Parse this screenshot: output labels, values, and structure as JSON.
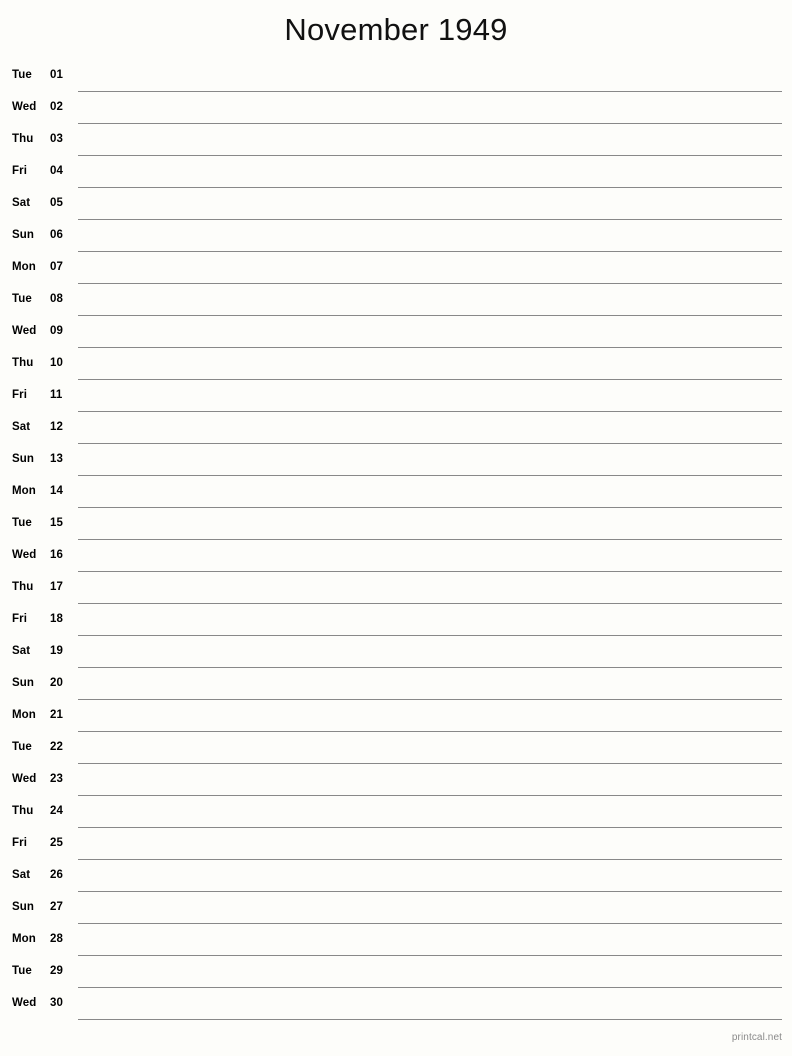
{
  "document": {
    "type": "printable-monthly-calendar",
    "title": "November 1949",
    "month": "November",
    "year": "1949"
  },
  "footer": {
    "watermark": "printcal.net"
  },
  "colors": {
    "background": "#fdfdfa",
    "text": "#000000",
    "rule_line": "#888888",
    "footer_text": "#8a8a8a"
  },
  "days": [
    {
      "weekday": "Tue",
      "number": "01"
    },
    {
      "weekday": "Wed",
      "number": "02"
    },
    {
      "weekday": "Thu",
      "number": "03"
    },
    {
      "weekday": "Fri",
      "number": "04"
    },
    {
      "weekday": "Sat",
      "number": "05"
    },
    {
      "weekday": "Sun",
      "number": "06"
    },
    {
      "weekday": "Mon",
      "number": "07"
    },
    {
      "weekday": "Tue",
      "number": "08"
    },
    {
      "weekday": "Wed",
      "number": "09"
    },
    {
      "weekday": "Thu",
      "number": "10"
    },
    {
      "weekday": "Fri",
      "number": "11"
    },
    {
      "weekday": "Sat",
      "number": "12"
    },
    {
      "weekday": "Sun",
      "number": "13"
    },
    {
      "weekday": "Mon",
      "number": "14"
    },
    {
      "weekday": "Tue",
      "number": "15"
    },
    {
      "weekday": "Wed",
      "number": "16"
    },
    {
      "weekday": "Thu",
      "number": "17"
    },
    {
      "weekday": "Fri",
      "number": "18"
    },
    {
      "weekday": "Sat",
      "number": "19"
    },
    {
      "weekday": "Sun",
      "number": "20"
    },
    {
      "weekday": "Mon",
      "number": "21"
    },
    {
      "weekday": "Tue",
      "number": "22"
    },
    {
      "weekday": "Wed",
      "number": "23"
    },
    {
      "weekday": "Thu",
      "number": "24"
    },
    {
      "weekday": "Fri",
      "number": "25"
    },
    {
      "weekday": "Sat",
      "number": "26"
    },
    {
      "weekday": "Sun",
      "number": "27"
    },
    {
      "weekday": "Mon",
      "number": "28"
    },
    {
      "weekday": "Tue",
      "number": "29"
    },
    {
      "weekday": "Wed",
      "number": "30"
    }
  ]
}
